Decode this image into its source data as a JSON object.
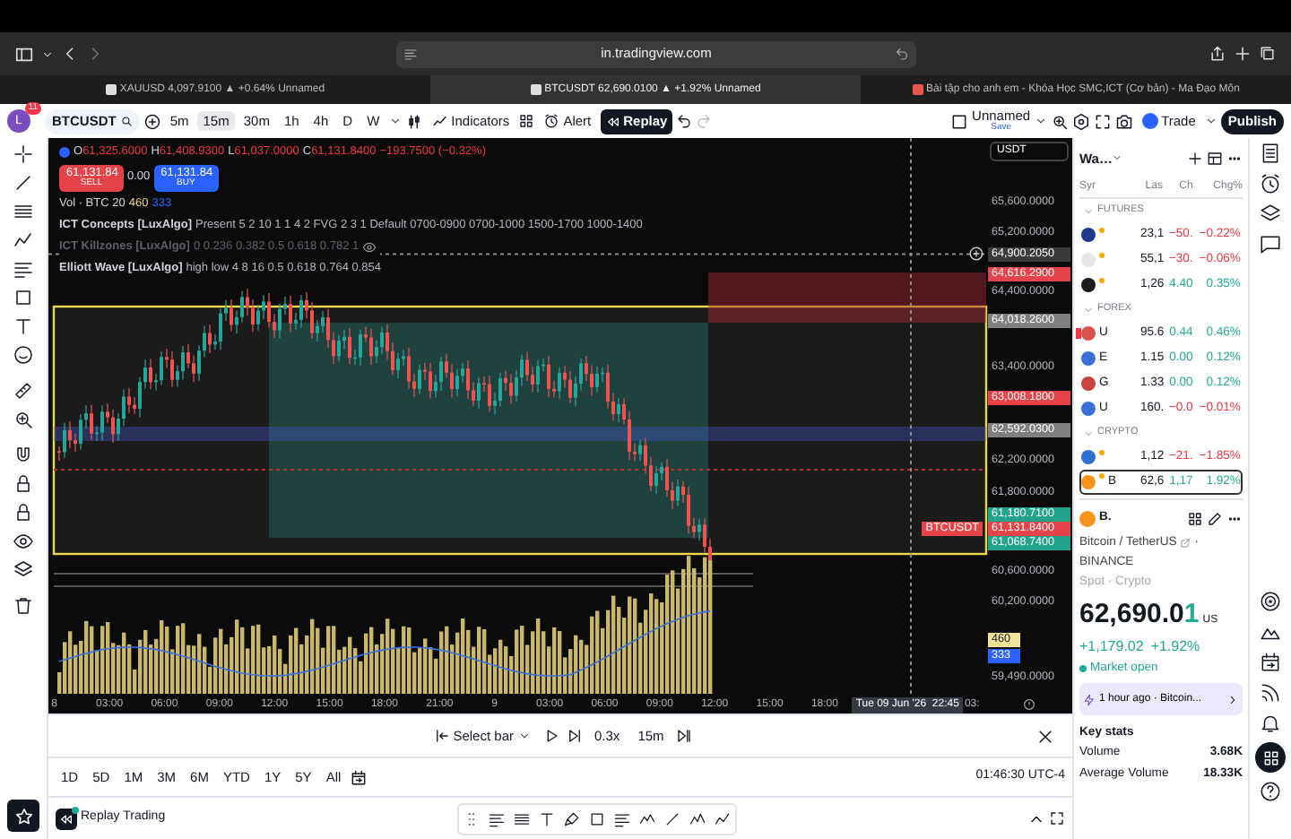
{
  "browser": {
    "url": "in.tradingview.com",
    "tabs": [
      {
        "label": "XAUUSD 4,097.9100 ▲ +0.64% Unnamed",
        "selected": false
      },
      {
        "label": "BTCUSDT 62,690.0100 ▲ +1.92% Unnamed",
        "selected": true
      },
      {
        "label": "Bài tập cho anh em - Khóa Học SMC,ICT (Cơ bản) - Ma Đạo Môn",
        "selected": false
      }
    ]
  },
  "toolbar": {
    "avatar": "L",
    "notifications": "11",
    "symbol": "BTCUSDT",
    "intervals": [
      {
        "label": "5m",
        "selected": false
      },
      {
        "label": "15m",
        "selected": true
      },
      {
        "label": "30m",
        "selected": false
      },
      {
        "label": "1h",
        "selected": false
      },
      {
        "label": "4h",
        "selected": false
      },
      {
        "label": "D",
        "selected": false
      },
      {
        "label": "W",
        "selected": false
      }
    ],
    "indicators": "Indicators",
    "alert": "Alert",
    "replay": {
      "label": "Replay",
      "active": true
    },
    "layout": {
      "name": "Unnamed",
      "status": "Save"
    },
    "trade": "Trade",
    "publish": "Publish"
  },
  "chart": {
    "legend": {
      "ohlc": [
        {
          "label": "O",
          "value": "61,325.6000"
        },
        {
          "label": "H",
          "value": "61,408.9300"
        },
        {
          "label": "L",
          "value": "61,037.0000"
        },
        {
          "label": "C",
          "value": "61,131.8400"
        }
      ],
      "change": "−193.7500 (−0.32%)",
      "sell": {
        "price": "61,131.84",
        "label": "SELL"
      },
      "spread": "0.00",
      "buy": {
        "price": "61,131.84",
        "label": "BUY"
      },
      "volume": {
        "label": "Vol · BTC 20",
        "values": [
          {
            "text": "460",
            "color": "#e6d68a"
          },
          {
            "text": "333",
            "color": "#2962ff"
          }
        ]
      },
      "indicators": [
        {
          "name": "ICT Concepts [LuxAlgo]",
          "params": "Present 5 2 10 1 1 4 2 FVG 2 3 1 Default 0700-0900 0700-1000 1500-1700 1000-1400",
          "hidden": false
        },
        {
          "name": "ICT Killzones [LuxAlgo]",
          "params": "0 0.236 0.382 0.5 0.618 0.782 1",
          "hidden": true
        },
        {
          "name": "Elliott Wave [LuxAlgo]",
          "params": "high low 4 8 16 0.5 0.618 0.764 0.854",
          "hidden": false
        }
      ]
    },
    "price_axis": {
      "currency": "USDT",
      "items": [
        {
          "kind": "label",
          "text": "65,600.0000"
        },
        {
          "kind": "label",
          "text": "65,200.0000"
        },
        {
          "kind": "tag",
          "text": "64,900.2050",
          "color": "#3b3b3b"
        },
        {
          "kind": "tag",
          "text": "64,616.2900",
          "color": "#e5434a"
        },
        {
          "kind": "label",
          "text": "64,400.0000"
        },
        {
          "kind": "tag",
          "text": "64,018.2600",
          "color": "#7f7f7f"
        },
        {
          "kind": "label",
          "text": "63,400.0000"
        },
        {
          "kind": "tag",
          "text": "63,008.1800",
          "color": "#e5434a"
        },
        {
          "kind": "tag",
          "text": "62,592.0300",
          "color": "#7f7f7f"
        },
        {
          "kind": "label",
          "text": "62,200.0000"
        },
        {
          "kind": "label",
          "text": "61,800.0000"
        },
        {
          "kind": "tag",
          "text": "61,180.7100",
          "color": "#22a38a"
        },
        {
          "kind": "tag",
          "text": "61,131.8400",
          "color": "#e5434a"
        },
        {
          "kind": "tag",
          "text": "61,068.7400",
          "color": "#22a38a"
        },
        {
          "kind": "label",
          "text": "60,600.0000"
        },
        {
          "kind": "label",
          "text": "60,200.0000"
        },
        {
          "kind": "tag",
          "text": "460",
          "color": "#f3e39a"
        },
        {
          "kind": "tag",
          "text": "333",
          "color": "#2962ff"
        },
        {
          "kind": "label",
          "text": "59,490.0000"
        }
      ]
    },
    "last_price_symbol": "BTCUSDT",
    "time_axis": {
      "labels": [
        "8",
        "03:00",
        "06:00",
        "09:00",
        "12:00",
        "15:00",
        "18:00",
        "21:00",
        "9",
        "03:00",
        "06:00",
        "09:00",
        "12:00",
        "15:00",
        "18:00"
      ],
      "crosshair": "Tue 09 Jun '26  22:45",
      "next": "03:"
    }
  },
  "replay_bar": {
    "select": "Select bar",
    "speed": "0.3x",
    "interval": "15m"
  },
  "ranges": {
    "items": [
      "1D",
      "5D",
      "1M",
      "3M",
      "6M",
      "YTD",
      "1Y",
      "5Y",
      "All"
    ],
    "clock": "01:46:30 UTC-4"
  },
  "bottom_bar": {
    "title": "Replay Trading"
  },
  "watchlist": {
    "title": "Wa…",
    "columns": [
      "Syr",
      "Las",
      "Ch",
      "Chg%"
    ],
    "groups": [
      {
        "name": "FUTURES",
        "expanded": true,
        "rows": [
          {
            "last": "23,1",
            "change": "−50.",
            "percent": "−0.22%",
            "rising": false,
            "color": "#1f3a8a",
            "delayed": true,
            "flagged": false,
            "selected": false
          },
          {
            "last": "55,1",
            "change": "−30.",
            "percent": "−0.06%",
            "rising": false,
            "color": "#e6e6e6",
            "delayed": true,
            "flagged": false,
            "selected": false
          },
          {
            "last": "1,26",
            "change": "4.40",
            "percent": "0.35%",
            "rising": true,
            "color": "#1c1c1c",
            "delayed": true,
            "flagged": false,
            "selected": false
          }
        ]
      },
      {
        "name": "FOREX",
        "expanded": true,
        "rows": [
          {
            "symbol": "U",
            "last": "95.6",
            "change": "0.44",
            "percent": "0.46%",
            "rising": true,
            "color": "#d9534f",
            "delayed": false,
            "flagged": true,
            "selected": false
          },
          {
            "symbol": "E",
            "last": "1.15",
            "change": "0.00",
            "percent": "0.12%",
            "rising": true,
            "color": "#3b6fd8",
            "delayed": false,
            "flagged": false,
            "selected": false
          },
          {
            "symbol": "G",
            "last": "1.33",
            "change": "0.00",
            "percent": "0.12%",
            "rising": true,
            "color": "#c8443f",
            "delayed": false,
            "flagged": false,
            "selected": false
          },
          {
            "symbol": "U",
            "last": "160.",
            "change": "−0.0",
            "percent": "−0.01%",
            "rising": false,
            "color": "#3b6fd8",
            "delayed": false,
            "flagged": false,
            "selected": false
          }
        ]
      },
      {
        "name": "CRYPTO",
        "expanded": true,
        "rows": [
          {
            "last": "1,12",
            "change": "−21.",
            "percent": "−1.85%",
            "rising": false,
            "color": "#2f6fd1",
            "delayed": true,
            "flagged": false,
            "selected": false
          },
          {
            "symbol": "B",
            "last": "62,6",
            "change": "1,17",
            "percent": "1.92%",
            "rising": true,
            "color": "#f7931a",
            "delayed": true,
            "flagged": false,
            "selected": true
          }
        ]
      }
    ]
  },
  "details": {
    "symbol": "B.",
    "name": "Bitcoin / TetherUS",
    "separator": "·",
    "exchange": "BINANCE",
    "type": "Spot · Crypto",
    "price": "62,690.0",
    "price_last_digit": "1",
    "currency": "US",
    "change": "+1,179.02",
    "change_percent": "+1.92%",
    "rising": true,
    "status": "Market open",
    "news": {
      "time": "1 hour ago ·",
      "headline": "Bitcoin..."
    },
    "key_stats_title": "Key stats",
    "stats": [
      {
        "label": "Volume",
        "value": "3.68K"
      },
      {
        "label": "Average Volume",
        "value": "18.33K"
      }
    ]
  }
}
